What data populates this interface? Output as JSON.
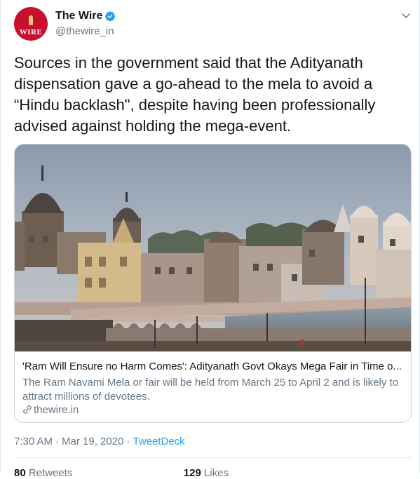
{
  "account": {
    "name": "The Wire",
    "handle": "@thewire_in",
    "avatar_text": "WIRE",
    "verified": true,
    "brand_color": "#c8102e"
  },
  "tweet": {
    "text": "Sources in the government said that the Adityanath dispensation gave a go-ahead to the mela to avoid a “Hindu backlash\", despite having been professionally advised against holding the mega-event."
  },
  "card": {
    "title": "'Ram Will Ensure no Harm Comes': Adityanath Govt Okays Mega Fair in Time o...",
    "description": "The Ram Navami Mela or fair will be held from March 25 to April 2 and is likely to attract millions of devotees.",
    "domain": "thewire.in",
    "icons": {
      "link": "link-icon"
    }
  },
  "meta": {
    "time": "7:30 AM",
    "date": "Mar 19, 2020",
    "source": "TweetDeck",
    "source_color": "#1da1f2"
  },
  "stats": {
    "retweets_count": "80",
    "retweets_label": "Retweets",
    "likes_count": "129",
    "likes_label": "Likes"
  },
  "icons": {
    "verified": "verified-badge-icon",
    "menu": "chevron-down-icon"
  }
}
